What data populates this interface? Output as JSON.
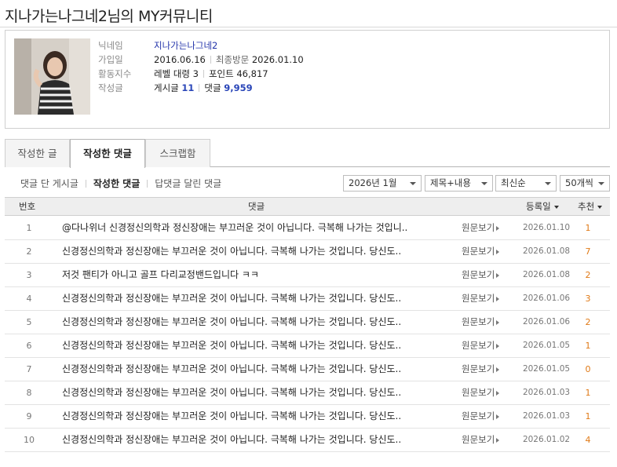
{
  "page": {
    "title": "지나가는나그네2님의 MY커뮤니티"
  },
  "profile": {
    "nickname_label": "닉네임",
    "nickname": "지나가는나그네2",
    "joined_label": "가입일",
    "joined": "2016.06.16",
    "last_visit_label": "최종방문",
    "last_visit": "2026.01.10",
    "activity_label": "활동지수",
    "level": "레벨 대령 3",
    "points": "포인트 46,817",
    "writing_label": "작성글",
    "posts_label": "게시글",
    "posts": "11",
    "comments_label": "댓글",
    "comments": "9,959"
  },
  "tabs": [
    {
      "label": "작성한 글"
    },
    {
      "label": "작성한 댓글"
    },
    {
      "label": "스크랩함"
    }
  ],
  "subfilters": [
    {
      "label": "댓글 단 게시글"
    },
    {
      "label": "작성한 댓글"
    },
    {
      "label": "답댓글 달린 댓글"
    }
  ],
  "filters": {
    "month": "2026년 1월",
    "search_scope": "제목+내용",
    "sort": "최신순",
    "page_size": "50개씩"
  },
  "table": {
    "headers": {
      "num": "번호",
      "comment": "댓글",
      "date": "등록일",
      "recommend": "추천"
    },
    "view_label": "원문보기",
    "rows": [
      {
        "num": "1",
        "comment": "@다나위너 신경정신의학과 정신장애는 부끄러운 것이 아닙니다. 극복해 나가는 것입니..",
        "date": "2026.01.10",
        "rec": "1"
      },
      {
        "num": "2",
        "comment": "신경정신의학과 정신장애는 부끄러운 것이 아닙니다. 극복해 나가는 것입니다. 당신도..",
        "date": "2026.01.08",
        "rec": "7"
      },
      {
        "num": "3",
        "comment": "저것 팬티가 아니고 골프 다리교정밴드입니다 ㅋㅋ",
        "date": "2026.01.08",
        "rec": "2"
      },
      {
        "num": "4",
        "comment": "신경정신의학과 정신장애는 부끄러운 것이 아닙니다. 극복해 나가는 것입니다. 당신도..",
        "date": "2026.01.06",
        "rec": "3"
      },
      {
        "num": "5",
        "comment": "신경정신의학과 정신장애는 부끄러운 것이 아닙니다. 극복해 나가는 것입니다. 당신도..",
        "date": "2026.01.06",
        "rec": "2"
      },
      {
        "num": "6",
        "comment": "신경정신의학과 정신장애는 부끄러운 것이 아닙니다. 극복해 나가는 것입니다. 당신도..",
        "date": "2026.01.05",
        "rec": "1"
      },
      {
        "num": "7",
        "comment": "신경정신의학과 정신장애는 부끄러운 것이 아닙니다. 극복해 나가는 것입니다. 당신도..",
        "date": "2026.01.05",
        "rec": "0"
      },
      {
        "num": "8",
        "comment": "신경정신의학과 정신장애는 부끄러운 것이 아닙니다. 극복해 나가는 것입니다. 당신도..",
        "date": "2026.01.03",
        "rec": "1"
      },
      {
        "num": "9",
        "comment": "신경정신의학과 정신장애는 부끄러운 것이 아닙니다. 극복해 나가는 것입니다. 당신도..",
        "date": "2026.01.03",
        "rec": "1"
      },
      {
        "num": "10",
        "comment": "신경정신의학과 정신장애는 부끄러운 것이 아닙니다. 극복해 나가는 것입니다. 당신도..",
        "date": "2026.01.02",
        "rec": "4"
      }
    ]
  },
  "colors": {
    "accent_blue": "#2a46b8",
    "recommend_orange": "#e07a17",
    "header_bg": "#eeeeee"
  }
}
